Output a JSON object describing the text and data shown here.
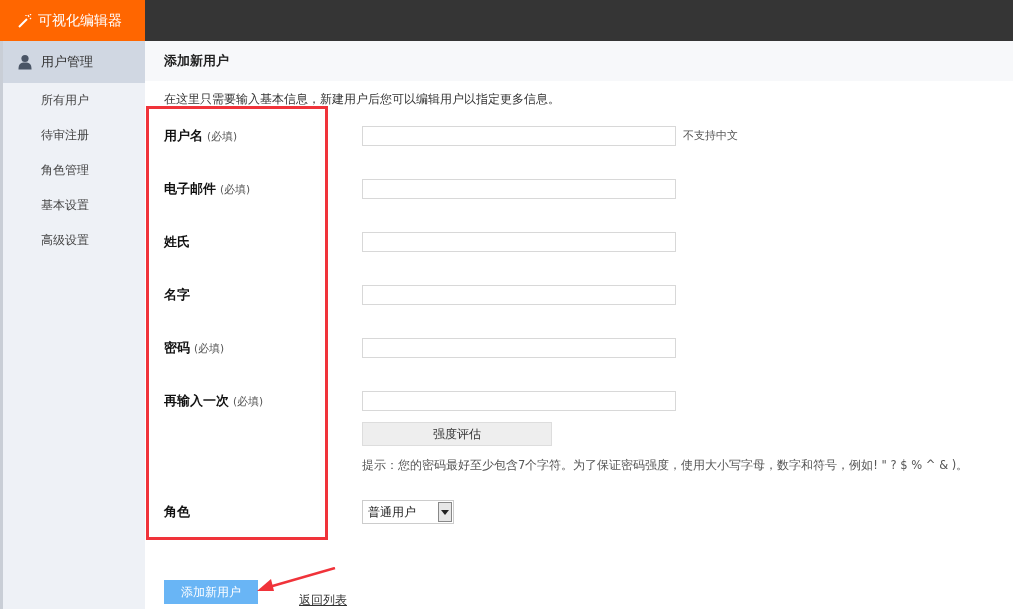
{
  "app": {
    "title": "可视化编辑器"
  },
  "sidebar": {
    "section": {
      "label": "用户管理",
      "selected": true
    },
    "items": [
      {
        "label": "所有用户",
        "selected": false
      },
      {
        "label": "待审注册",
        "selected": false
      },
      {
        "label": "角色管理",
        "selected": false
      },
      {
        "label": "基本设置",
        "selected": false
      },
      {
        "label": "高级设置",
        "selected": false
      }
    ]
  },
  "page": {
    "title": "添加新用户",
    "description": "在这里只需要输入基本信息，新建用户后您可以编辑用户以指定更多信息。"
  },
  "form": {
    "fields": [
      {
        "kind": "text",
        "label": "用户名",
        "required_note": "(必填)",
        "hint": "不支持中文"
      },
      {
        "kind": "text",
        "label": "电子邮件",
        "required_note": "(必填)"
      },
      {
        "kind": "text",
        "label": "姓氏"
      },
      {
        "kind": "text",
        "label": "名字"
      },
      {
        "kind": "password",
        "label": "密码",
        "required_note": "(必填)"
      },
      {
        "kind": "password_confirm",
        "label": "再输入一次",
        "required_note": "(必填)",
        "strength_button": "强度评估",
        "tip": "提示：您的密码最好至少包含7个字符。为了保证密码强度，使用大小写字母，数字和符号，例如! \" ? $ % ^ & )。"
      },
      {
        "kind": "select",
        "label": "角色",
        "value": "普通用户"
      }
    ],
    "submit": "添加新用户",
    "back_link": "返回列表"
  }
}
